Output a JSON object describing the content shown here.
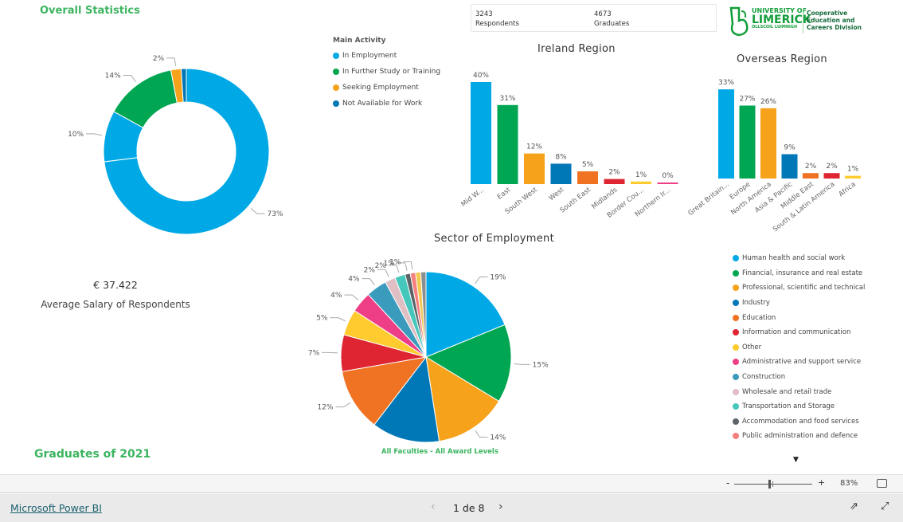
{
  "overall_title": "Overall Statistics",
  "footer_title": "Graduates of 2021",
  "kpi": {
    "respondents_value": "3243",
    "respondents_label": "Respondents",
    "graduates_value": "4673",
    "graduates_label": "Graduates"
  },
  "logo": {
    "line1": "UNIVERSITY OF",
    "line2": "LIMERICK",
    "line3": "OLLSCOIL LUIMNIGH",
    "division": [
      "Cooperative",
      "Education and",
      "Careers Division"
    ]
  },
  "salary": {
    "value": "€ 37.422",
    "label": "Average Salary of Respondents"
  },
  "chart_data": [
    {
      "type": "pie",
      "variant": "donut",
      "legend_title": "Main Activity",
      "legend_placement": "right",
      "legend": [
        {
          "name": "In Employment",
          "color": "#00a9e6"
        },
        {
          "name": "In Further Study or Training",
          "color": "#00a651"
        },
        {
          "name": "Seeking Employment",
          "color": "#f7a21b"
        },
        {
          "name": "Not Available for Work",
          "color": "#0077b6"
        }
      ],
      "slices": [
        {
          "value": 73,
          "label": "73%",
          "color": "#00a9e6"
        },
        {
          "value": 10,
          "label": "10%",
          "color": "#00a9e6"
        },
        {
          "value": 14,
          "label": "14%",
          "color": "#00a651"
        },
        {
          "value": 2,
          "label": "2%",
          "color": "#f7a21b"
        },
        {
          "value": 1,
          "label": "",
          "color": "#0077b6"
        }
      ]
    },
    {
      "type": "bar",
      "title": "Ireland Region",
      "categories": [
        "Mid W...",
        "East",
        "South West",
        "West",
        "South East",
        "Midlands",
        "Border Cou...",
        "Northern Ir..."
      ],
      "values": [
        40,
        31,
        12,
        8,
        5,
        2,
        1,
        0
      ],
      "labels": [
        "40%",
        "31%",
        "12%",
        "8%",
        "5%",
        "2%",
        "1%",
        "0%"
      ],
      "colors": [
        "#00a9e6",
        "#00a651",
        "#f7a21b",
        "#0077b6",
        "#f07323",
        "#de2531",
        "#ffcb2f",
        "#ee3f86"
      ]
    },
    {
      "type": "bar",
      "title": "Overseas Region",
      "categories": [
        "Great Britain...",
        "Europe",
        "North America",
        "Asia & Pacific",
        "Middle East",
        "South & Latin America",
        "Africa"
      ],
      "values": [
        33,
        27,
        26,
        9,
        2,
        2,
        1
      ],
      "labels": [
        "33%",
        "27%",
        "26%",
        "9%",
        "2%",
        "2%",
        "1%"
      ],
      "colors": [
        "#00a9e6",
        "#00a651",
        "#f7a21b",
        "#0077b6",
        "#f07323",
        "#de2531",
        "#ffcb2f"
      ]
    },
    {
      "type": "pie",
      "title": "Sector of Employment",
      "subtitle": "All Faculties - All Award Levels",
      "legend_placement": "right",
      "slices": [
        {
          "name": "Human health and social work",
          "value": 19,
          "label": "19%",
          "color": "#00a9e6"
        },
        {
          "name": "Financial, insurance and real estate",
          "value": 15,
          "label": "15%",
          "color": "#00a651"
        },
        {
          "name": "Professional, scientific and technical",
          "value": 14,
          "label": "14%",
          "color": "#f7a21b"
        },
        {
          "name": "Industry",
          "value": 13,
          "label": "",
          "color": "#0077b6"
        },
        {
          "name": "Education",
          "value": 12,
          "label": "12%",
          "color": "#f07323"
        },
        {
          "name": "Information and communication",
          "value": 7,
          "label": "7%",
          "color": "#de2531"
        },
        {
          "name": "Other",
          "value": 5,
          "label": "5%",
          "color": "#ffcb2f"
        },
        {
          "name": "Administrative and support service",
          "value": 4,
          "label": "4%",
          "color": "#ee3f86"
        },
        {
          "name": "Construction",
          "value": 4,
          "label": "4%",
          "color": "#3a9bbc"
        },
        {
          "name": "Wholesale and retail trade",
          "value": 2,
          "label": "2%",
          "color": "#dfbfc4"
        },
        {
          "name": "Transportation and Storage",
          "value": 2,
          "label": "2%",
          "color": "#46c7bb"
        },
        {
          "name": "Accommodation and food services",
          "value": 1,
          "label": "1%",
          "color": "#5c6368"
        },
        {
          "name": "Public administration and defence",
          "value": 1,
          "label": "1%",
          "color": "#f5807d"
        },
        {
          "value": 1,
          "label": "",
          "color": "#f2ca50"
        },
        {
          "value": 1,
          "label": "",
          "color": "#8a8f8f"
        }
      ]
    }
  ],
  "zoom": {
    "minus": "-",
    "plus": "+",
    "level": "83%",
    "level_fraction": 0.45
  },
  "footer": {
    "link": "Microsoft Power BI",
    "page": "1 de 8"
  }
}
